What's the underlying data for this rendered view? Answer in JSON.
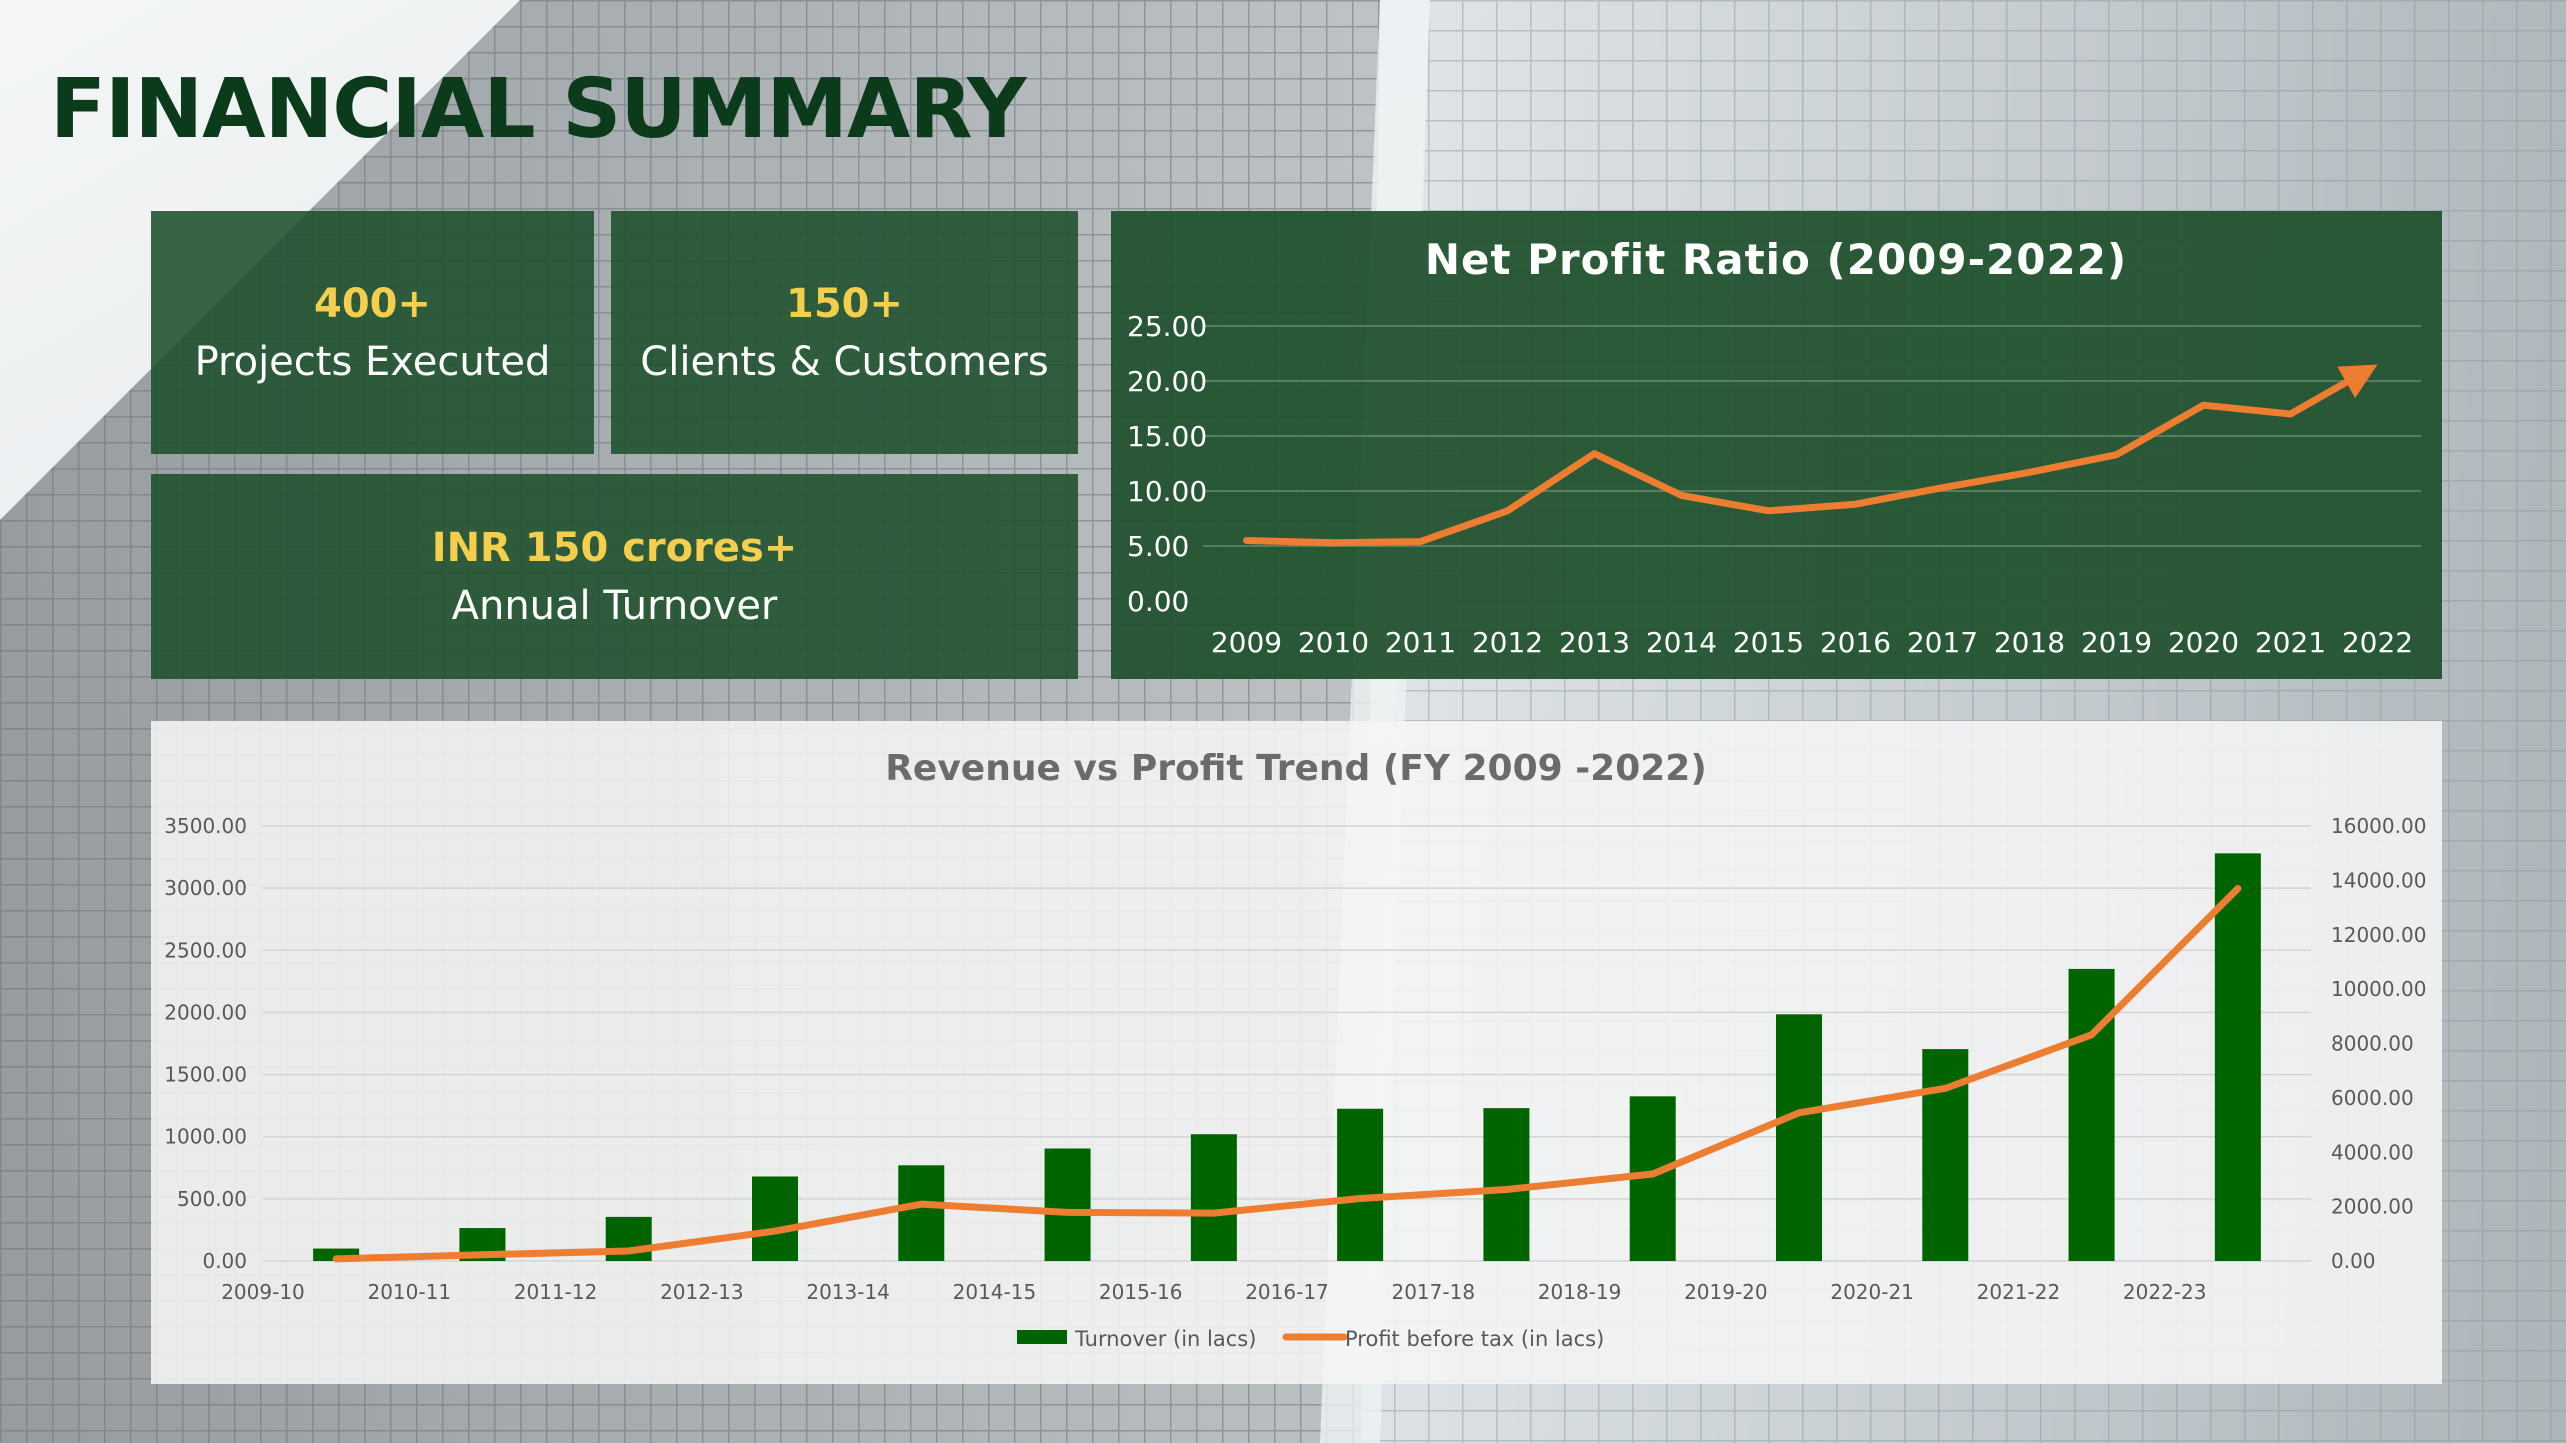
{
  "page": {
    "title": "FINANCIAL SUMMARY"
  },
  "stats": {
    "projects": {
      "value": "400+",
      "label": "Projects Executed"
    },
    "clients": {
      "value": "150+",
      "label": "Clients & Customers"
    },
    "turnover": {
      "value": "INR 150 crores+",
      "label": "Annual Turnover"
    }
  },
  "colors": {
    "dark_green": "#0c3b1c",
    "panel_green": "#1e502c",
    "highlight_yellow": "#f3cf4d",
    "bar_green": "#006400",
    "line_orange": "#ed7d31"
  },
  "chart_data": [
    {
      "type": "line",
      "title": "Net Profit Ratio (2009-2022)",
      "x": [
        "2009",
        "2010",
        "2011",
        "2012",
        "2013",
        "2014",
        "2015",
        "2016",
        "2017",
        "2018",
        "2019",
        "2020",
        "2021",
        "2022"
      ],
      "series": [
        {
          "values": [
            5.5,
            5.3,
            5.4,
            8.2,
            13.4,
            9.6,
            8.2,
            8.8,
            10.3,
            11.7,
            13.3,
            17.8,
            17.0,
            21.5
          ]
        }
      ],
      "ylim": [
        0,
        25
      ],
      "yticks": [
        "0.00",
        "5.00",
        "10.00",
        "15.00",
        "20.00",
        "25.00"
      ],
      "grid": true,
      "end_marker": "arrow",
      "line_color": "#ed7d31"
    },
    {
      "type": "bar",
      "title": "Revenue vs Profit Trend (FY 2009 -2022)",
      "categories": [
        "2009-10",
        "2010-11",
        "2011-12",
        "2012-13",
        "2013-14",
        "2014-15",
        "2015-16",
        "2016-17",
        "2017-18",
        "2018-19",
        "2019-20",
        "2020-21",
        "2021-22",
        "2022-23"
      ],
      "series": [
        {
          "name": "Turnover (in lacs)",
          "type": "bar",
          "axis": "left",
          "color": "#006400",
          "values": [
            100,
            265,
            355,
            680,
            770,
            905,
            1020,
            1225,
            1230,
            1325,
            1985,
            1705,
            2350,
            3280
          ]
        },
        {
          "name": "Profit before tax (in lacs)",
          "type": "line",
          "axis": "right",
          "color": "#ed7d31",
          "values": [
            80,
            230,
            370,
            1100,
            2090,
            1790,
            1760,
            2300,
            2630,
            3200,
            5450,
            6350,
            8320,
            13700
          ]
        }
      ],
      "ylim_left": [
        0,
        3500
      ],
      "yticks_left": [
        "0.00",
        "500.00",
        "1000.00",
        "1500.00",
        "2000.00",
        "2500.00",
        "3000.00",
        "3500.00"
      ],
      "ylim_right": [
        0,
        16000
      ],
      "yticks_right": [
        "0.00",
        "2000.00",
        "4000.00",
        "6000.00",
        "8000.00",
        "10000.00",
        "12000.00",
        "14000.00",
        "16000.00"
      ],
      "grid": true,
      "legend_position": "bottom"
    }
  ]
}
